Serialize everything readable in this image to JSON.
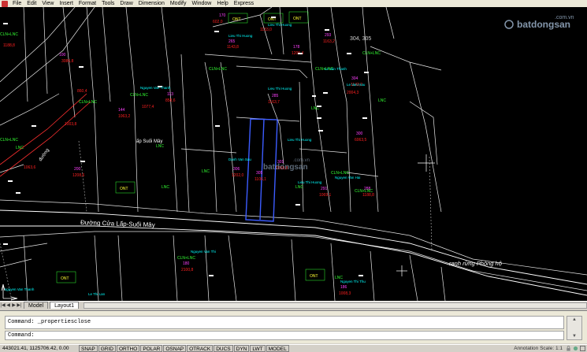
{
  "menubar": {
    "items": [
      "File",
      "Edit",
      "View",
      "Insert",
      "Format",
      "Tools",
      "Draw",
      "Dimension",
      "Modify",
      "Window",
      "Help",
      "Express"
    ]
  },
  "watermark": {
    "domain": ".com.vn",
    "brand": "batdongsan"
  },
  "drawing": {
    "road_label": "Đường Cửa Lấp-Suối Mây",
    "area_label": "ấp Suối Mây",
    "forest_label": "ranh rừng Phòng hộ",
    "street_label": "đường",
    "parcel_pair": "304, 305",
    "land_code_onr": "ONT",
    "land_code_cln": "CLN+LNC",
    "land_code_lnc": "LNC",
    "accent_colors": {
      "cyan": "#00ffff",
      "red": "#ff2020",
      "magenta": "#ff40ff",
      "green": "#33ff33",
      "white": "#ffffff",
      "blue": "#3c5cff",
      "yellow": "#ffff33"
    }
  },
  "tabs": {
    "model": "Model",
    "layout1": "Layout1"
  },
  "command": {
    "history": "Command: _propertiesclose",
    "prompt": "Command:"
  },
  "status": {
    "coords": "443021.41, 1125706.42, 0.00",
    "toggles": [
      "SNAP",
      "GRID",
      "ORTHO",
      "POLAR",
      "OSNAP",
      "OTRACK",
      "DUCS",
      "DYN",
      "LWT",
      "MODEL"
    ],
    "annotation_scale": "Annotation Scale: 1:1"
  }
}
